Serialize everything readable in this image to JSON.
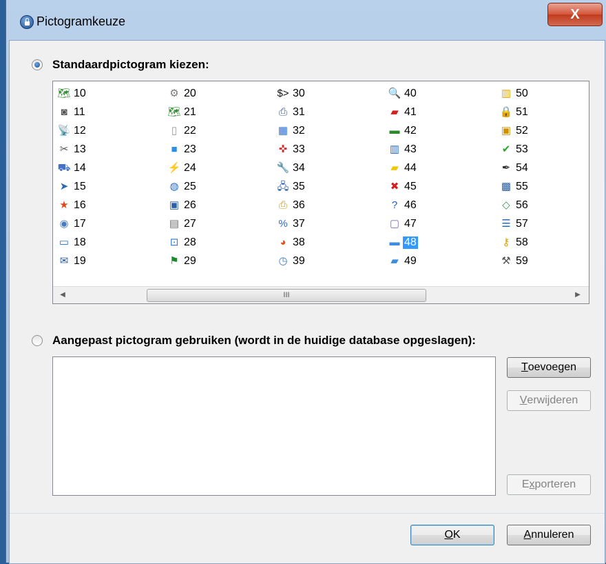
{
  "window": {
    "title": "Pictogramkeuze",
    "close_label": "X"
  },
  "standard": {
    "radio_label": "Standaardpictogram kiezen:",
    "selected": "48",
    "columns": [
      [
        {
          "num": "10",
          "icon": "map-icon",
          "glyph": "🗺",
          "color": "#3a8f3a"
        },
        {
          "num": "11",
          "icon": "camera-icon",
          "glyph": "◙",
          "color": "#555"
        },
        {
          "num": "12",
          "icon": "antenna-icon",
          "glyph": "📡",
          "color": "#c33"
        },
        {
          "num": "13",
          "icon": "tools-icon",
          "glyph": "✂",
          "color": "#555"
        },
        {
          "num": "14",
          "icon": "printer-scan-icon",
          "glyph": "⛟",
          "color": "#4472c4"
        },
        {
          "num": "15",
          "icon": "paper-plane-icon",
          "glyph": "➤",
          "color": "#2e6bb8"
        },
        {
          "num": "16",
          "icon": "star-globe-icon",
          "glyph": "★",
          "color": "#e04a1a"
        },
        {
          "num": "17",
          "icon": "cd-icon",
          "glyph": "◉",
          "color": "#4a7bc0"
        },
        {
          "num": "18",
          "icon": "monitor-icon",
          "glyph": "▭",
          "color": "#1c6fd0"
        },
        {
          "num": "19",
          "icon": "envelope-icon",
          "glyph": "✉",
          "color": "#2e5fa6"
        }
      ],
      [
        {
          "num": "20",
          "icon": "gear-icon",
          "glyph": "⚙",
          "color": "#777"
        },
        {
          "num": "21",
          "icon": "map-check-icon",
          "glyph": "🗺",
          "color": "#3a8f3a"
        },
        {
          "num": "22",
          "icon": "blank-page-icon",
          "glyph": "▯",
          "color": "#999"
        },
        {
          "num": "23",
          "icon": "window-blue-icon",
          "glyph": "■",
          "color": "#2f8ee6"
        },
        {
          "num": "24",
          "icon": "lightning-network-icon",
          "glyph": "⚡",
          "color": "#e0a000"
        },
        {
          "num": "25",
          "icon": "globe-doc-icon",
          "glyph": "◍",
          "color": "#2a6ac4"
        },
        {
          "num": "26",
          "icon": "floppy-icon",
          "glyph": "▣",
          "color": "#2a5ea8"
        },
        {
          "num": "27",
          "icon": "server-icon",
          "glyph": "▤",
          "color": "#707070"
        },
        {
          "num": "28",
          "icon": "search-window-icon",
          "glyph": "⊡",
          "color": "#2c7bd0"
        },
        {
          "num": "29",
          "icon": "key-flag-icon",
          "glyph": "⚑",
          "color": "#1a8a2a"
        }
      ],
      [
        {
          "num": "30",
          "icon": "terminal-icon",
          "glyph": "$>",
          "color": "#111"
        },
        {
          "num": "31",
          "icon": "printer-icon",
          "glyph": "⎙",
          "color": "#3a5f90"
        },
        {
          "num": "32",
          "icon": "windows-grid-icon",
          "glyph": "▦",
          "color": "#2d6fd4"
        },
        {
          "num": "33",
          "icon": "puzzle-icon",
          "glyph": "✜",
          "color": "#d03030"
        },
        {
          "num": "34",
          "icon": "wrench-icon",
          "glyph": "🔧",
          "color": "#808080"
        },
        {
          "num": "35",
          "icon": "computers-network-icon",
          "glyph": "🖧",
          "color": "#2a5ea8"
        },
        {
          "num": "36",
          "icon": "printer-doc-icon",
          "glyph": "⎙",
          "color": "#c99a20"
        },
        {
          "num": "37",
          "icon": "percent-icon",
          "glyph": "%",
          "color": "#2a6ac4"
        },
        {
          "num": "38",
          "icon": "monitor-colors-icon",
          "glyph": "◕",
          "color": "#e05a20"
        },
        {
          "num": "39",
          "icon": "clock-icon",
          "glyph": "◷",
          "color": "#3a7ac8"
        }
      ],
      [
        {
          "num": "40",
          "icon": "magnifier-icon",
          "glyph": "🔍",
          "color": "#4a7bc0"
        },
        {
          "num": "41",
          "icon": "doc-pin-icon",
          "glyph": "▰",
          "color": "#d02020"
        },
        {
          "num": "42",
          "icon": "memory-chip-icon",
          "glyph": "▬",
          "color": "#2a8a2a"
        },
        {
          "num": "43",
          "icon": "trash-icon",
          "glyph": "▥",
          "color": "#2a6ac4"
        },
        {
          "num": "44",
          "icon": "note-icon",
          "glyph": "▰",
          "color": "#f0c800"
        },
        {
          "num": "45",
          "icon": "red-x-icon",
          "glyph": "✖",
          "color": "#d42020"
        },
        {
          "num": "46",
          "icon": "help-icon",
          "glyph": "?",
          "color": "#1f5fbf"
        },
        {
          "num": "47",
          "icon": "box-icon",
          "glyph": "▢",
          "color": "#8a6ac0"
        },
        {
          "num": "48",
          "icon": "folder-icon",
          "glyph": "▬",
          "color": "#3a8de0"
        },
        {
          "num": "49",
          "icon": "folder-open-icon",
          "glyph": "▰",
          "color": "#3a8de0"
        }
      ],
      [
        {
          "num": "50",
          "icon": "database-folder-icon",
          "glyph": "▥",
          "color": "#e0a800"
        },
        {
          "num": "51",
          "icon": "padlock-icon",
          "glyph": "🔒",
          "color": "#e0a000"
        },
        {
          "num": "52",
          "icon": "lock-frame-icon",
          "glyph": "▣",
          "color": "#d09000"
        },
        {
          "num": "53",
          "icon": "checkmark-icon",
          "glyph": "✔",
          "color": "#2aa82a"
        },
        {
          "num": "54",
          "icon": "pen-icon",
          "glyph": "✒",
          "color": "#333"
        },
        {
          "num": "55",
          "icon": "picture-icon",
          "glyph": "▩",
          "color": "#2a5ea8"
        },
        {
          "num": "56",
          "icon": "eraser-icon",
          "glyph": "◇",
          "color": "#3a9a5a"
        },
        {
          "num": "57",
          "icon": "list-icon",
          "glyph": "☰",
          "color": "#2a6ac4"
        },
        {
          "num": "58",
          "icon": "users-key-icon",
          "glyph": "⚷",
          "color": "#e0a000"
        },
        {
          "num": "59",
          "icon": "hammer-icon",
          "glyph": "⚒",
          "color": "#555"
        }
      ]
    ],
    "scroll_grip": "III"
  },
  "custom": {
    "radio_label": "Aangepast pictogram gebruiken (wordt in de huidige database opgeslagen):",
    "add": {
      "mnemonic": "T",
      "rest": "oevoegen"
    },
    "remove": {
      "mnemonic": "V",
      "rest": "erwijderen"
    },
    "export": {
      "pre": "E",
      "mnemonic": "x",
      "rest": "porteren"
    }
  },
  "footer": {
    "ok": {
      "mnemonic": "O",
      "rest": "K"
    },
    "cancel": {
      "mnemonic": "A",
      "rest": "nnuleren"
    }
  }
}
